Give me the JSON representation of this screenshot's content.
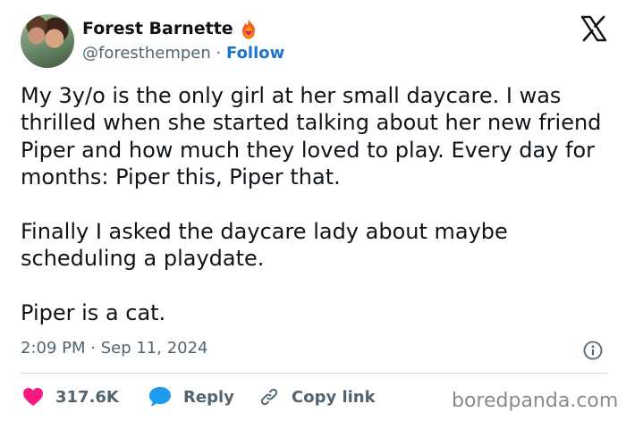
{
  "author": {
    "name": "Forest Barnette",
    "handle": "@foresthempen",
    "separator": "·",
    "follow_label": "Follow"
  },
  "tweet": {
    "paragraphs": [
      "My 3y/o is the only girl at her small daycare. I was thrilled when she started talking about her new friend Piper and how much they loved to play. Every day for months: Piper this, Piper that.",
      "Finally I asked the daycare lady about maybe scheduling a playdate.",
      "Piper is a cat."
    ],
    "timestamp": "2:09 PM · Sep 11, 2024"
  },
  "actions": {
    "likes_count": "317.6K",
    "reply_label": "Reply",
    "copy_link_label": "Copy link"
  },
  "watermark": "boredpanda.com",
  "icons": {
    "flame": "flame-heart-icon",
    "brand": "x-logo-icon",
    "info": "info-icon",
    "heart": "heart-icon",
    "reply": "speech-bubble-icon",
    "link": "link-icon"
  },
  "colors": {
    "text": "#0f1419",
    "secondary": "#536471",
    "follow": "#1d74c9",
    "heart": "#f91880",
    "reply": "#1d9bf0",
    "divider": "#cfd9de"
  }
}
